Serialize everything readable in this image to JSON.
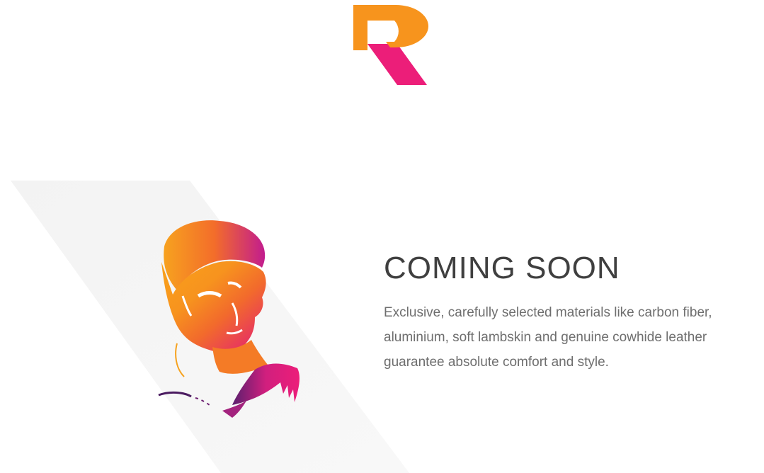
{
  "brand": {
    "logo_icon": "r-logo-icon",
    "colors": {
      "orange": "#F7941D",
      "pink": "#EC1E79",
      "stripe": "#F6F6F6"
    }
  },
  "hero": {
    "illustration_icon": "watercolor-man-portrait-icon",
    "title": "COMING SOON",
    "description": "Exclusive, carefully selected materials like carbon fiber, aluminium, soft lambskin and genuine cowhide leather guarantee absolute comfort and style."
  }
}
